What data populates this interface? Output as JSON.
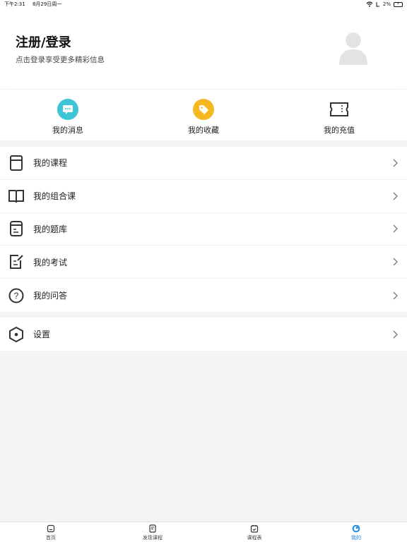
{
  "status_bar": {
    "time": "下午2:31",
    "date": "8月29日周一",
    "battery": "2%"
  },
  "profile": {
    "title": "注册/登录",
    "subtitle": "点击登录享受更多精彩信息"
  },
  "quick_actions": [
    {
      "label": "我的消息",
      "icon": "message-icon",
      "color": "#3ec6d8"
    },
    {
      "label": "我的收藏",
      "icon": "tag-icon",
      "color": "#f5b820"
    },
    {
      "label": "我的充值",
      "icon": "ticket-icon",
      "color": "#333333"
    }
  ],
  "menu": [
    {
      "label": "我的课程",
      "icon": "book-icon"
    },
    {
      "label": "我的组合课",
      "icon": "open-book-icon"
    },
    {
      "label": "我的题库",
      "icon": "question-bank-icon"
    },
    {
      "label": "我的考试",
      "icon": "exam-icon"
    },
    {
      "label": "我的问答",
      "icon": "question-icon"
    }
  ],
  "settings": {
    "label": "设置",
    "icon": "hexagon-settings-icon"
  },
  "tabs": [
    {
      "label": "首页",
      "icon": "home-icon"
    },
    {
      "label": "发现课程",
      "icon": "discover-icon"
    },
    {
      "label": "课程表",
      "icon": "calendar-icon"
    },
    {
      "label": "我的",
      "icon": "profile-icon",
      "active": true
    }
  ],
  "colors": {
    "accent": "#1e88e5",
    "background": "#f4f4f4"
  }
}
